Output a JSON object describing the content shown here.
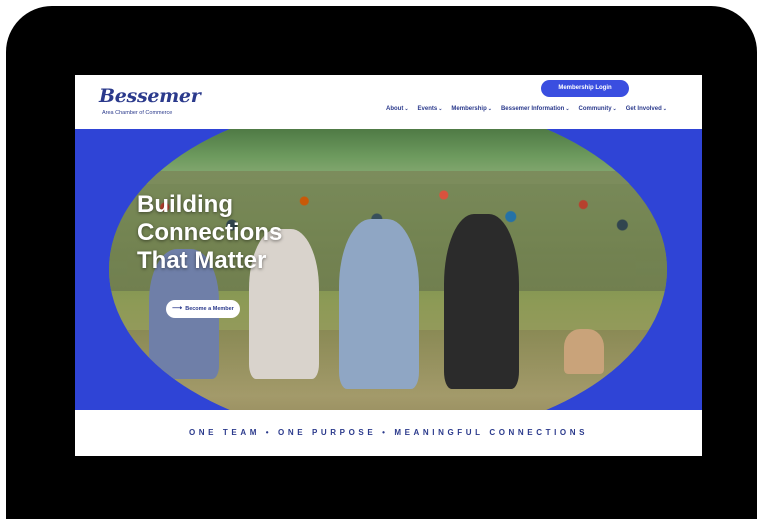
{
  "header": {
    "logo_main": "Bessemer",
    "logo_sub": "Area Chamber of Commerce",
    "login_label": "Membership Login",
    "nav": [
      {
        "label": "About",
        "has_dropdown": true
      },
      {
        "label": "Events",
        "has_dropdown": true
      },
      {
        "label": "Membership",
        "has_dropdown": true
      },
      {
        "label": "Bessemer Information",
        "has_dropdown": true
      },
      {
        "label": "Community",
        "has_dropdown": true
      },
      {
        "label": "Get Involved",
        "has_dropdown": true
      }
    ],
    "chevron_glyph": "⌄"
  },
  "hero": {
    "title_lines": [
      "Building",
      "Connections",
      "That Matter"
    ],
    "cta_label": "Become a Member",
    "cta_icon": "arrow-right-icon"
  },
  "tagline": "ONE TEAM • ONE PURPOSE • MEANINGFUL CONNECTIONS",
  "colors": {
    "brand_blue": "#2f44d6",
    "button_blue": "#3a4ee0",
    "text_navy": "#2b3a8c",
    "frame_black": "#000000"
  }
}
